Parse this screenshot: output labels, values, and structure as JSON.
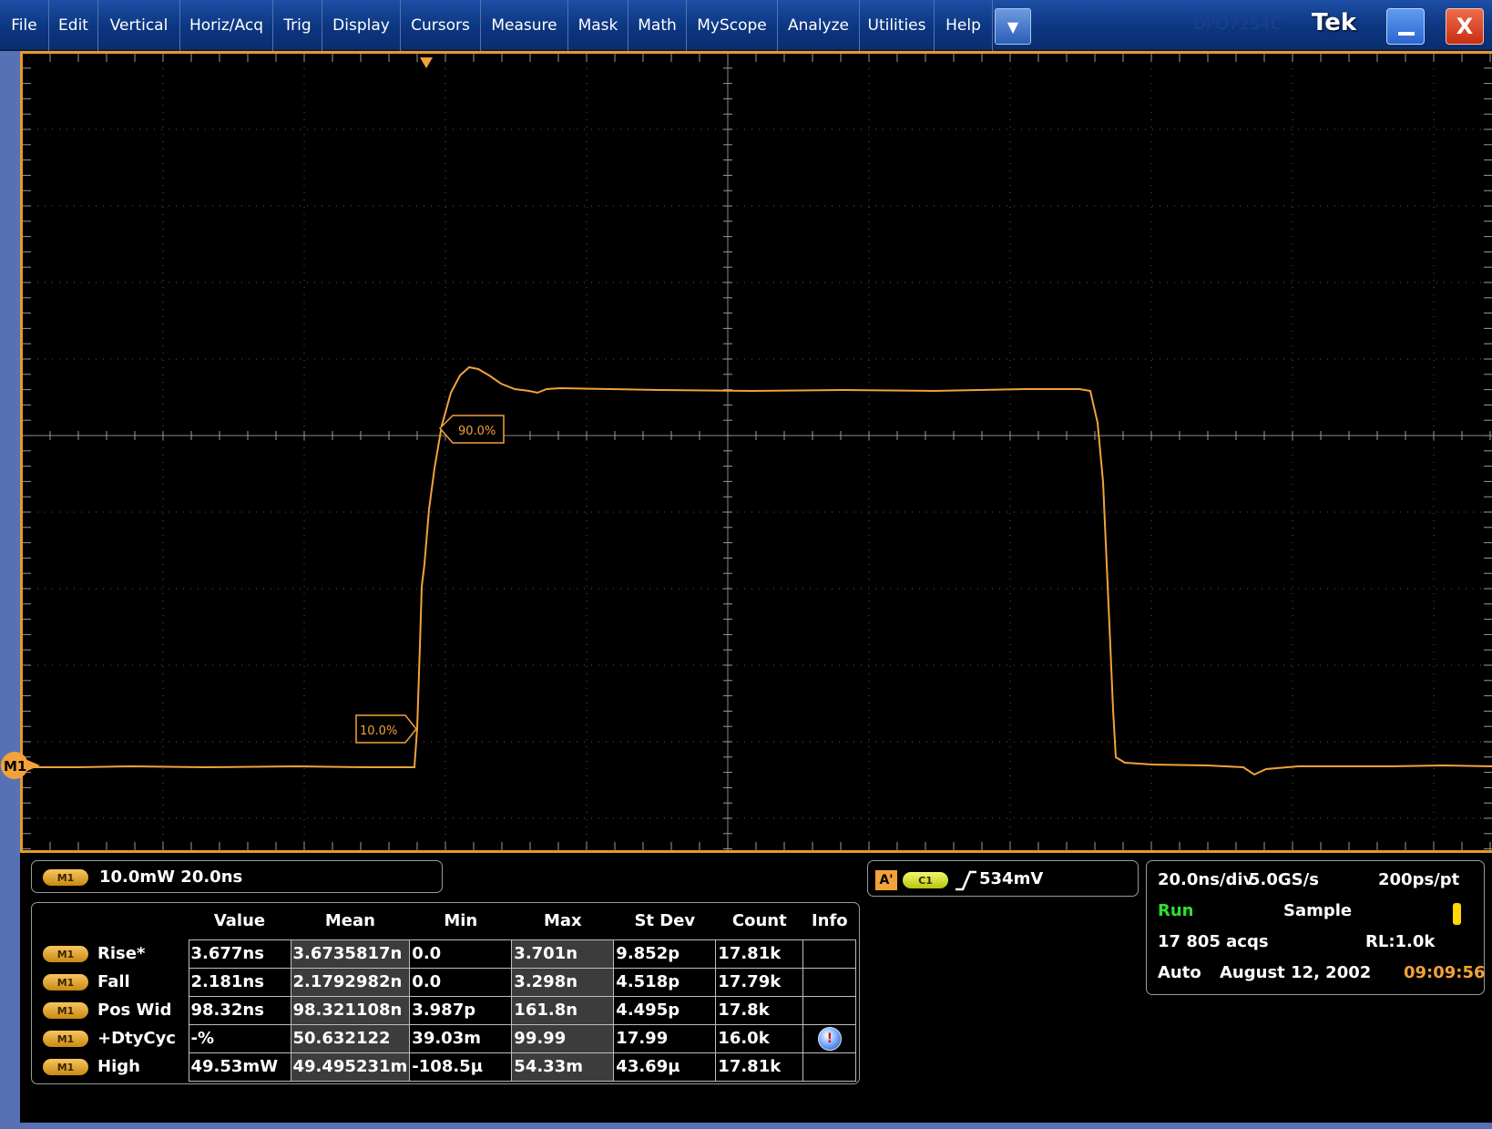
{
  "menubar": {
    "items": [
      "File",
      "Edit",
      "Vertical",
      "Horiz/Acq",
      "Trig",
      "Display",
      "Cursors",
      "Measure",
      "Mask",
      "Math",
      "MyScope",
      "Analyze",
      "Utilities",
      "Help"
    ],
    "dropdown_glyph": "▼",
    "model": "DPO7254C",
    "brand": "Tek",
    "close_glyph": "X"
  },
  "waveform": {
    "color": "#f2a23a",
    "reference_label": "M1",
    "ref_90_label": "90.0%",
    "ref_10_label": "10.0%"
  },
  "scale_readout": {
    "badge": "M1",
    "text": "10.0mW 20.0ns"
  },
  "trigger": {
    "label": "A'",
    "source": "C1",
    "level": "534mV"
  },
  "acquisition": {
    "horizontal_scale": "20.0ns/div",
    "sample_rate": "5.0GS/s",
    "point_resolution": "200ps/pt",
    "state": "Run",
    "mode": "Sample",
    "acq_count": "17 805 acqs",
    "record_length": "RL:1.0k",
    "trigger_mode": "Auto",
    "date": "August 12, 2002",
    "time": "09:09:56"
  },
  "measurements": {
    "headers": [
      "Value",
      "Mean",
      "Min",
      "Max",
      "St Dev",
      "Count",
      "Info"
    ],
    "rows": [
      {
        "badge": "M1",
        "name": "Rise*",
        "value": "3.677ns",
        "mean": "3.6735817n",
        "min": "0.0",
        "max": "3.701n",
        "stdev": "9.852p",
        "count": "17.81k",
        "info": ""
      },
      {
        "badge": "M1",
        "name": "Fall",
        "value": "2.181ns",
        "mean": "2.1792982n",
        "min": "0.0",
        "max": "3.298n",
        "stdev": "4.518p",
        "count": "17.79k",
        "info": ""
      },
      {
        "badge": "M1",
        "name": "Pos Wid",
        "value": "98.32ns",
        "mean": "98.321108n",
        "min": "3.987p",
        "max": "161.8n",
        "stdev": "4.495p",
        "count": "17.8k",
        "info": ""
      },
      {
        "badge": "M1",
        "name": "+DtyCyc",
        "value": "-%",
        "mean": "50.632122",
        "min": "39.03m",
        "max": "99.99",
        "stdev": "17.99",
        "count": "16.0k",
        "info": "warning-icon"
      },
      {
        "badge": "M1",
        "name": "High",
        "value": "49.53mW",
        "mean": "49.495231m",
        "min": "-108.5µ",
        "max": "54.33m",
        "stdev": "43.69µ",
        "count": "17.81k",
        "info": ""
      }
    ]
  }
}
